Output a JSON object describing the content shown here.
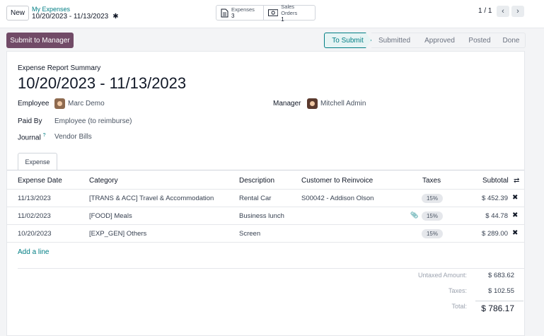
{
  "header": {
    "new_label": "New",
    "breadcrumb_parent": "My Expenses",
    "breadcrumb_current": "10/20/2023 - 11/13/2023",
    "smart_buttons": [
      {
        "label": "Expenses",
        "count": "3"
      },
      {
        "label": "Sales Orders",
        "count": "1"
      }
    ],
    "pager": "1 / 1"
  },
  "actions": {
    "submit_label": "Submit to Manager"
  },
  "statusbar": [
    "To Submit",
    "Submitted",
    "Approved",
    "Posted",
    "Done"
  ],
  "form": {
    "summary_label": "Expense Report Summary",
    "title": "10/20/2023 - 11/13/2023",
    "employee_label": "Employee",
    "employee_value": "Marc Demo",
    "manager_label": "Manager",
    "manager_value": "Mitchell Admin",
    "paid_by_label": "Paid By",
    "paid_by_value": "Employee (to reimburse)",
    "journal_label": "Journal",
    "journal_help": "?",
    "journal_value": "Vendor Bills"
  },
  "tab": {
    "label": "Expense"
  },
  "table": {
    "columns": [
      "Expense Date",
      "Category",
      "Description",
      "Customer to Reinvoice",
      "Taxes",
      "Subtotal"
    ],
    "rows": [
      {
        "date": "11/13/2023",
        "category": "[TRANS & ACC] Travel & Accommodation",
        "description": "Rental Car",
        "customer": "S00042 - Addison Olson",
        "tax": "15%",
        "subtotal": "$ 452.39"
      },
      {
        "date": "11/02/2023",
        "category": "[FOOD] Meals",
        "description": "Business lunch",
        "customer": "",
        "tax": "15%",
        "subtotal": "$ 44.78"
      },
      {
        "date": "10/20/2023",
        "category": "[EXP_GEN] Others",
        "description": "Screen",
        "customer": "",
        "tax": "15%",
        "subtotal": "$ 289.00"
      }
    ],
    "add_line": "Add a line"
  },
  "totals": {
    "untaxed_label": "Untaxed Amount:",
    "untaxed_value": "$ 683.62",
    "taxes_label": "Taxes:",
    "taxes_value": "$ 102.55",
    "total_label": "Total:",
    "total_value": "$ 786.17"
  },
  "colors": {
    "brand": "#714b67",
    "accent": "#017e84"
  }
}
